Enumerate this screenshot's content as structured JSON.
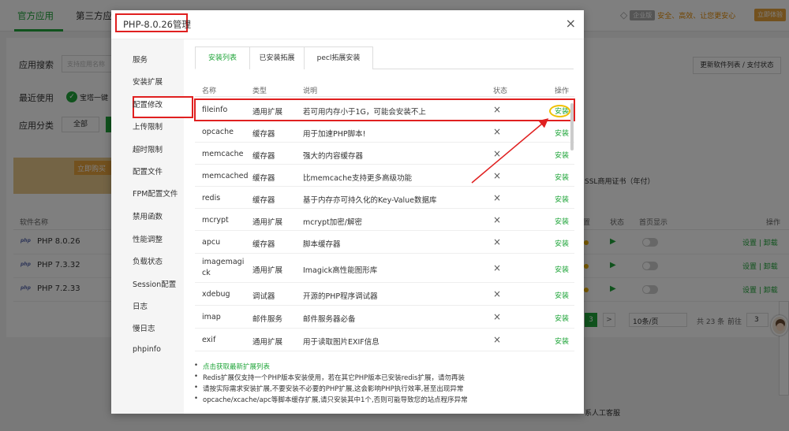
{
  "top_tabs": [
    "官方应用",
    "第三方应"
  ],
  "top_right": {
    "version_badge": "企业版",
    "slogan": "安全、高效、让您更安心",
    "try_button": "立即体验"
  },
  "search": {
    "label": "应用搜索",
    "placeholder": "支持应用名称"
  },
  "recent": {
    "label": "最近使用",
    "item": "宝塔一键"
  },
  "category": {
    "label": "应用分类",
    "all": "全部"
  },
  "promo_tag": "立即购买",
  "update_button": "更新软件列表 / 支付状态",
  "ssl_text": "SSL商用证书（年付）",
  "software_table": {
    "headers": [
      "软件名称",
      "置",
      "状态",
      "首页显示",
      "操作"
    ],
    "rows": [
      {
        "icon": "php",
        "name": "PHP 8.0.26",
        "ops": "设置 | 卸载"
      },
      {
        "icon": "php",
        "name": "PHP 7.3.32",
        "ops": "设置 | 卸载"
      },
      {
        "icon": "php",
        "name": "PHP 7.2.33",
        "ops": "设置 | 卸载"
      }
    ]
  },
  "pager": {
    "current": "3",
    "next": ">",
    "page_size": "10条/页",
    "total": "共 23 条",
    "goto": "前往",
    "page_input": "3"
  },
  "contact": "系人工客服",
  "modal": {
    "title": "PHP-8.0.26管理",
    "close": "×",
    "side_menu": [
      "服务",
      "安装扩展",
      "配置修改",
      "上传限制",
      "超时限制",
      "配置文件",
      "FPM配置文件",
      "禁用函数",
      "性能调整",
      "负载状态",
      "Session配置",
      "日志",
      "慢日志",
      "phpinfo"
    ],
    "tabs": [
      "安装列表",
      "已安装拓展",
      "pecl拓展安装"
    ],
    "table_headers": [
      "名称",
      "类型",
      "说明",
      "状态",
      "操作"
    ],
    "extensions": [
      {
        "name": "fileinfo",
        "type": "通用扩展",
        "desc": "若可用内存小于1G，可能会安装不上",
        "status": "×",
        "action": "安装"
      },
      {
        "name": "opcache",
        "type": "缓存器",
        "desc": "用于加速PHP脚本!",
        "status": "×",
        "action": "安装"
      },
      {
        "name": "memcache",
        "type": "缓存器",
        "desc": "强大的内容缓存器",
        "status": "×",
        "action": "安装"
      },
      {
        "name": "memcached",
        "type": "缓存器",
        "desc": "比memcache支持更多高级功能",
        "status": "×",
        "action": "安装"
      },
      {
        "name": "redis",
        "type": "缓存器",
        "desc": "基于内存亦可持久化的Key-Value数据库",
        "status": "×",
        "action": "安装"
      },
      {
        "name": "mcrypt",
        "type": "通用扩展",
        "desc": "mcrypt加密/解密",
        "status": "×",
        "action": "安装"
      },
      {
        "name": "apcu",
        "type": "缓存器",
        "desc": "脚本缓存器",
        "status": "×",
        "action": "安装"
      },
      {
        "name": "imagemagick",
        "type": "通用扩展",
        "desc": "Imagick高性能图形库",
        "status": "×",
        "action": "安装"
      },
      {
        "name": "xdebug",
        "type": "调试器",
        "desc": "开源的PHP程序调试器",
        "status": "×",
        "action": "安装"
      },
      {
        "name": "imap",
        "type": "邮件服务",
        "desc": "邮件服务器必备",
        "status": "×",
        "action": "安装"
      },
      {
        "name": "exif",
        "type": "通用扩展",
        "desc": "用于读取图片EXIF信息",
        "status": "×",
        "action": "安装"
      }
    ],
    "notes": [
      "点击获取最新扩展列表",
      "Redis扩展仅支持一个PHP版本安装使用，若在其它PHP版本已安装redis扩展，请勿再装",
      "请按实际需求安装扩展,不要安装不必要的PHP扩展,这会影响PHP执行效率,甚至出现异常",
      "opcache/xcache/apc等脚本缓存扩展,请只安装其中1个,否则可能导致您的站点程序异常"
    ]
  },
  "colors": {
    "accent": "#20a53a",
    "highlight": "#e02020",
    "circle": "#f0c000"
  }
}
